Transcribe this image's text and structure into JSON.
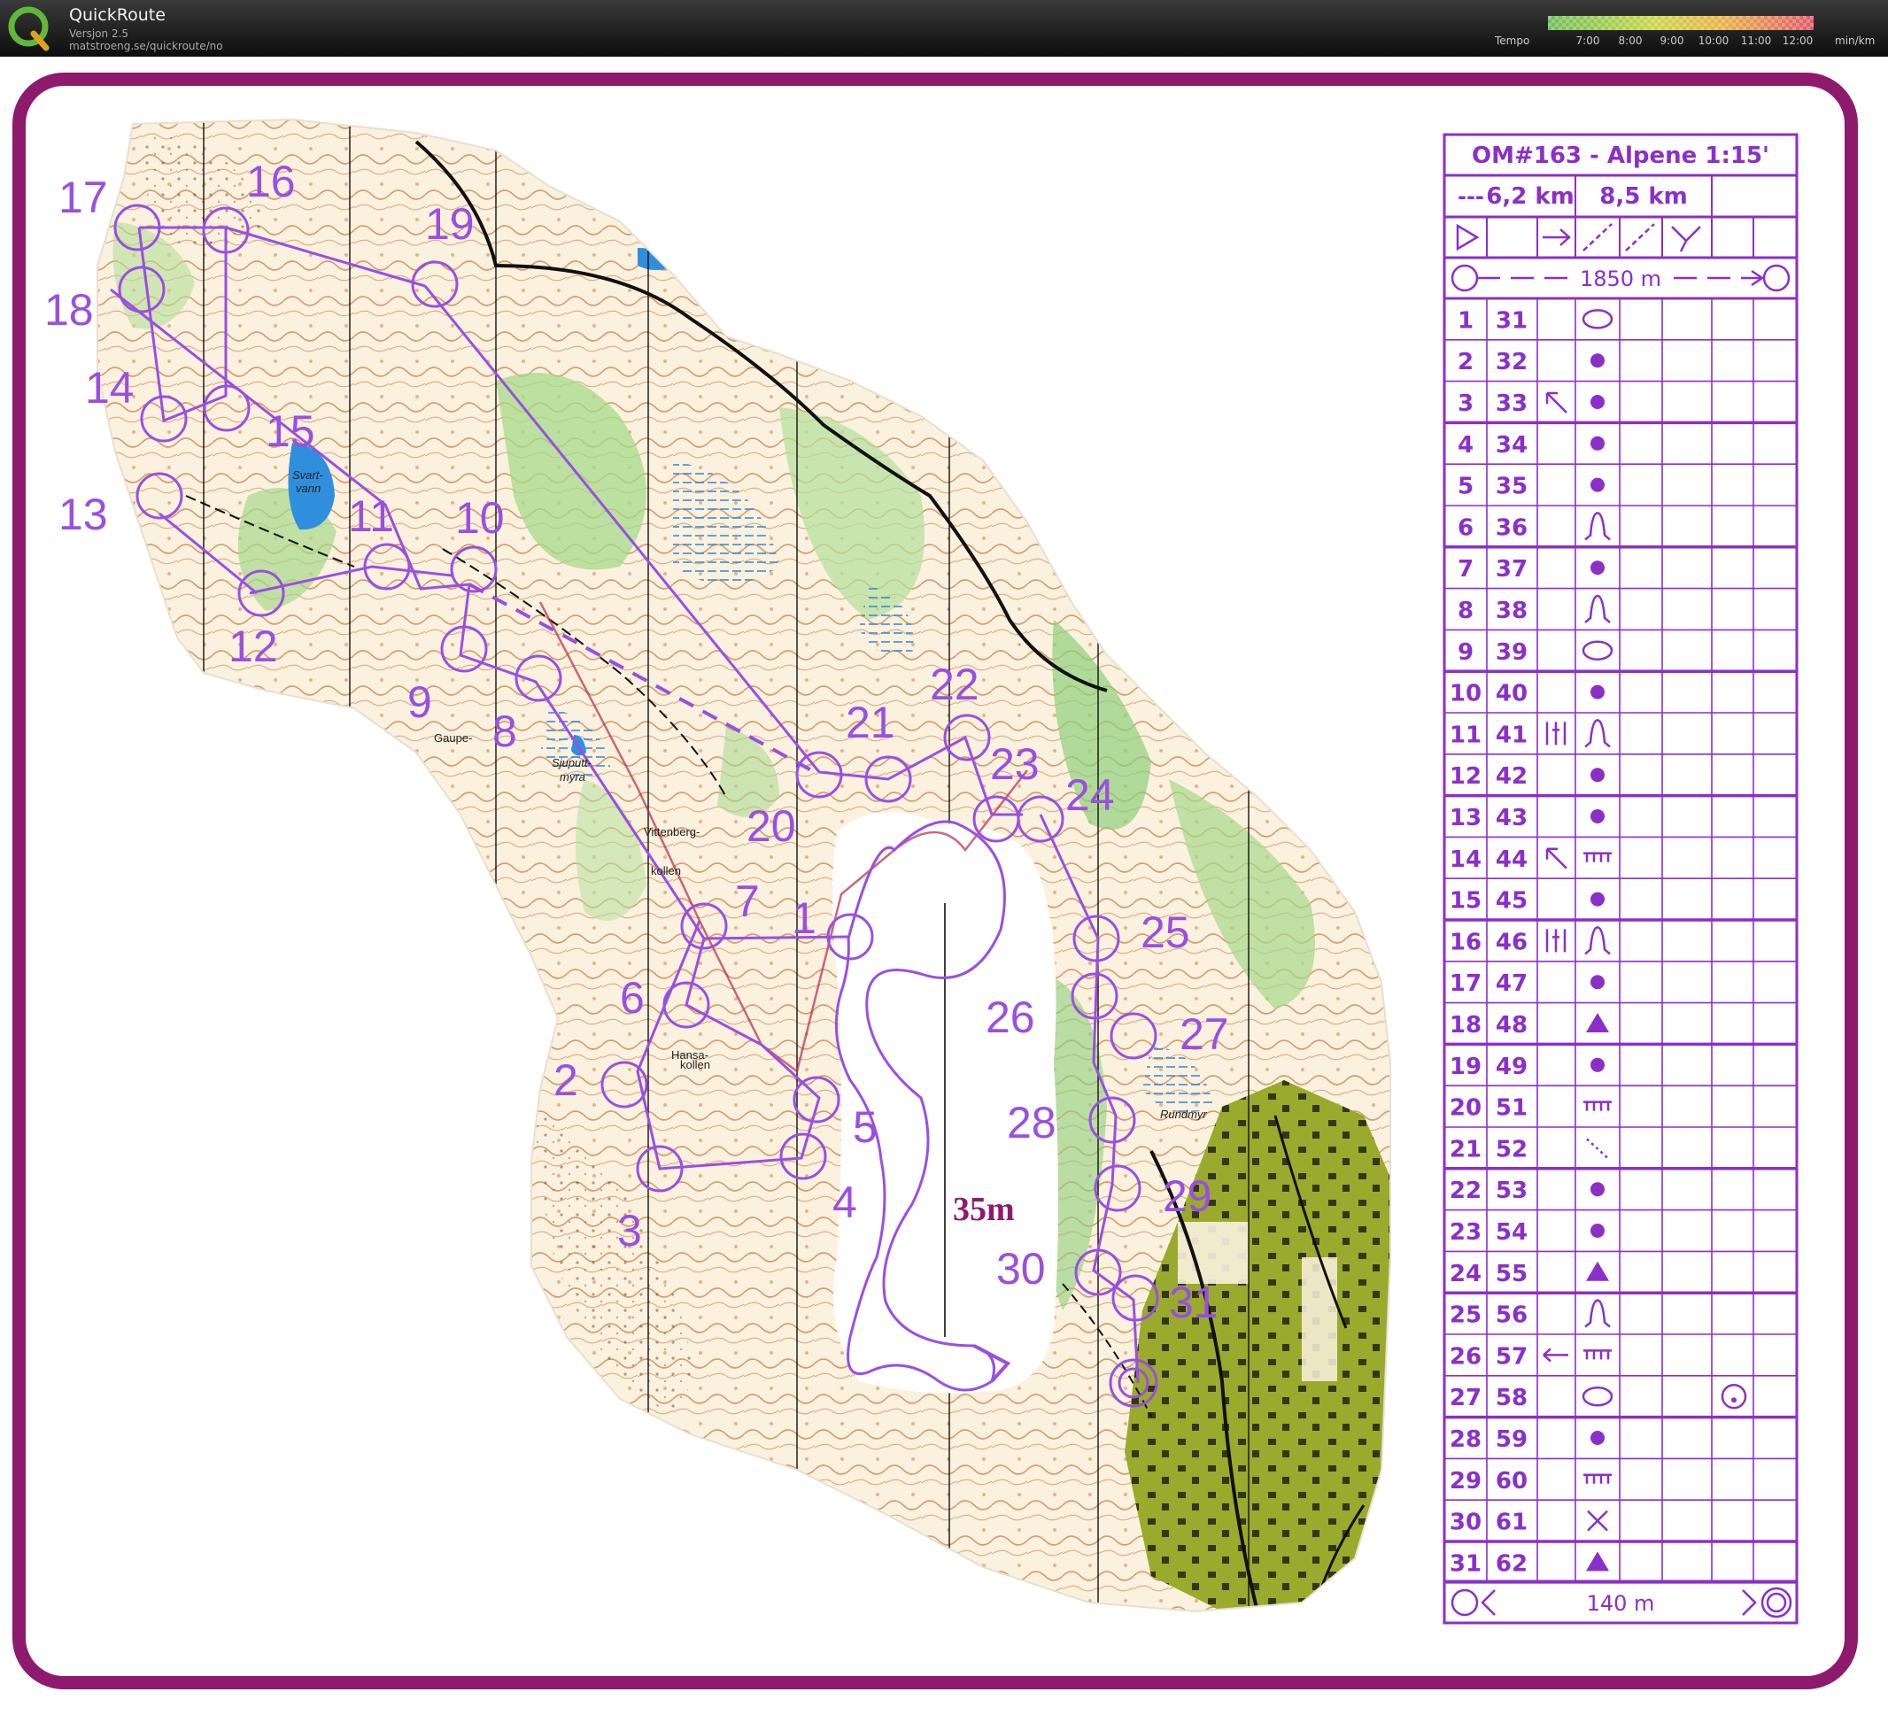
{
  "app": {
    "title": "QuickRoute",
    "version": "Versjon 2.5",
    "url": "matstroeng.se/quickroute/no"
  },
  "tempo": {
    "label": "Tempo",
    "ticks": [
      "7:00",
      "8:00",
      "9:00",
      "10:00",
      "11:00",
      "12:00"
    ],
    "unit": "min/km",
    "colors": [
      "#6fbf5a",
      "#e8d84a",
      "#e89a4a",
      "#e05a6a"
    ]
  },
  "colors": {
    "frame": "#8e1a6e",
    "course": "#9a4fe0",
    "description": "#8b2fc9"
  },
  "map": {
    "scale_label": "35m",
    "place_names": [
      "Svart-",
      "vann",
      "Gaupe-",
      "Sjuputt-",
      "myra",
      "Vittenberg-",
      "kollen",
      "Hansa-",
      "kollen",
      "Rundmyr"
    ],
    "controls": [
      "1",
      "2",
      "3",
      "4",
      "5",
      "6",
      "7",
      "8",
      "9",
      "10",
      "11",
      "12",
      "13",
      "14",
      "15",
      "16",
      "17",
      "18",
      "19",
      "20",
      "21",
      "22",
      "23",
      "24",
      "25",
      "26",
      "27",
      "28",
      "29",
      "30",
      "31"
    ]
  },
  "description": {
    "title": "OM#163 - Alpene 1:15'",
    "class_dashes": "---",
    "length_1": "6,2 km",
    "length_2": "8,5 km",
    "start_marked_route": "1850 m",
    "finish_route": "140 m",
    "rows": [
      {
        "no": "1",
        "code": "31",
        "dir": "",
        "feature": "ellipse",
        "extra": ""
      },
      {
        "no": "2",
        "code": "32",
        "dir": "",
        "feature": "dot",
        "extra": ""
      },
      {
        "no": "3",
        "code": "33",
        "dir": "nw-arrow",
        "feature": "dot",
        "extra": ""
      },
      {
        "no": "4",
        "code": "34",
        "dir": "",
        "feature": "dot",
        "extra": ""
      },
      {
        "no": "5",
        "code": "35",
        "dir": "",
        "feature": "dot",
        "extra": ""
      },
      {
        "no": "6",
        "code": "36",
        "dir": "",
        "feature": "knoll",
        "extra": ""
      },
      {
        "no": "7",
        "code": "37",
        "dir": "",
        "feature": "dot",
        "extra": ""
      },
      {
        "no": "8",
        "code": "38",
        "dir": "",
        "feature": "knoll",
        "extra": ""
      },
      {
        "no": "9",
        "code": "39",
        "dir": "",
        "feature": "ellipse",
        "extra": ""
      },
      {
        "no": "10",
        "code": "40",
        "dir": "",
        "feature": "dot",
        "extra": ""
      },
      {
        "no": "11",
        "code": "41",
        "dir": "between",
        "feature": "knoll",
        "extra": ""
      },
      {
        "no": "12",
        "code": "42",
        "dir": "",
        "feature": "dot",
        "extra": ""
      },
      {
        "no": "13",
        "code": "43",
        "dir": "",
        "feature": "dot",
        "extra": ""
      },
      {
        "no": "14",
        "code": "44",
        "dir": "nw-arrow",
        "feature": "cliff",
        "extra": ""
      },
      {
        "no": "15",
        "code": "45",
        "dir": "",
        "feature": "dot",
        "extra": ""
      },
      {
        "no": "16",
        "code": "46",
        "dir": "between",
        "feature": "knoll",
        "extra": ""
      },
      {
        "no": "17",
        "code": "47",
        "dir": "",
        "feature": "dot",
        "extra": ""
      },
      {
        "no": "18",
        "code": "48",
        "dir": "",
        "feature": "triangle",
        "extra": ""
      },
      {
        "no": "19",
        "code": "49",
        "dir": "",
        "feature": "dot",
        "extra": ""
      },
      {
        "no": "20",
        "code": "51",
        "dir": "",
        "feature": "cliff",
        "extra": ""
      },
      {
        "no": "21",
        "code": "52",
        "dir": "",
        "feature": "dotted-line",
        "extra": ""
      },
      {
        "no": "22",
        "code": "53",
        "dir": "",
        "feature": "dot",
        "extra": ""
      },
      {
        "no": "23",
        "code": "54",
        "dir": "",
        "feature": "dot",
        "extra": ""
      },
      {
        "no": "24",
        "code": "55",
        "dir": "",
        "feature": "triangle",
        "extra": ""
      },
      {
        "no": "25",
        "code": "56",
        "dir": "",
        "feature": "knoll",
        "extra": ""
      },
      {
        "no": "26",
        "code": "57",
        "dir": "w-arrow",
        "feature": "cliff",
        "extra": ""
      },
      {
        "no": "27",
        "code": "58",
        "dir": "",
        "feature": "ellipse",
        "extra": "circle-dot"
      },
      {
        "no": "28",
        "code": "59",
        "dir": "",
        "feature": "dot",
        "extra": ""
      },
      {
        "no": "29",
        "code": "60",
        "dir": "",
        "feature": "cliff",
        "extra": ""
      },
      {
        "no": "30",
        "code": "61",
        "dir": "",
        "feature": "cross",
        "extra": ""
      },
      {
        "no": "31",
        "code": "62",
        "dir": "",
        "feature": "triangle",
        "extra": ""
      }
    ]
  }
}
